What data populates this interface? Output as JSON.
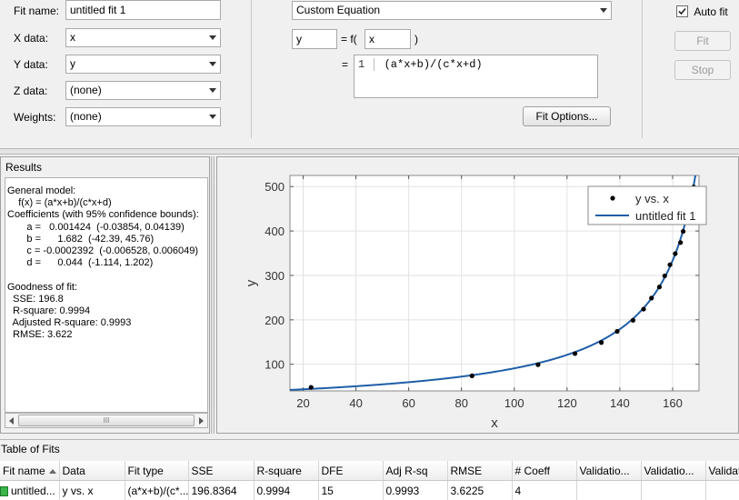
{
  "fit_name": {
    "label": "Fit name:",
    "value": "untitled fit 1"
  },
  "selectors": [
    {
      "label": "X data:",
      "value": "x"
    },
    {
      "label": "Y data:",
      "value": "y"
    },
    {
      "label": "Z data:",
      "value": "(none)"
    },
    {
      "label": "Weights:",
      "value": "(none)"
    }
  ],
  "equation": {
    "type": "Custom Equation",
    "lhs": "y",
    "func_prefix": "= f(",
    "arg": "x",
    "func_suffix": ")",
    "eq_prefix": "=",
    "line_number": "1",
    "expr": "(a*x+b)/(c*x+d)",
    "fit_options_label": "Fit Options..."
  },
  "controls": {
    "auto_fit_label": "Auto fit",
    "auto_fit_checked": true,
    "fit_label": "Fit",
    "stop_label": "Stop"
  },
  "results": {
    "title": "Results",
    "text": "General model:\n    f(x) = (a*x+b)/(c*x+d)\nCoefficients (with 95% confidence bounds):\n       a =   0.001424  (-0.03854, 0.04139)\n       b =      1.682  (-42.39, 45.76)\n       c = -0.0002392  (-0.006528, 0.006049)\n       d =      0.044  (-1.114, 1.202)\n\nGoodness of fit:\n  SSE: 196.8\n  R-square: 0.9994\n  Adjusted R-square: 0.9993\n  RMSE: 3.622",
    "scroll_thumb": "III"
  },
  "chart_data": {
    "type": "scatter",
    "xlabel": "x",
    "ylabel": "y",
    "xlim": [
      15,
      170
    ],
    "ylim": [
      40,
      525
    ],
    "xticks": [
      20,
      40,
      60,
      80,
      100,
      120,
      140,
      160
    ],
    "yticks": [
      100,
      200,
      300,
      400,
      500
    ],
    "grid": true,
    "legend_position": "top-right",
    "series": [
      {
        "name": "y vs. x",
        "kind": "points",
        "color": "#000000",
        "x": [
          23,
          84,
          109,
          123,
          133,
          139,
          145,
          149,
          152,
          155,
          157,
          159,
          161,
          163,
          164,
          165,
          168
        ],
        "y": [
          48,
          74,
          99,
          124,
          149,
          174,
          199,
          224,
          249,
          274,
          299,
          324,
          349,
          374,
          399,
          424,
          499
        ]
      },
      {
        "name": "untitled fit 1",
        "kind": "line",
        "color": "#1f5ea8",
        "model": {
          "a": 0.001424,
          "b": 1.682,
          "c": -0.0002392,
          "d": 0.044
        }
      }
    ]
  },
  "table": {
    "title": "Table of Fits",
    "columns": [
      "Fit name",
      "Data",
      "Fit type",
      "SSE",
      "R-square",
      "DFE",
      "Adj R-sq",
      "RMSE",
      "# Coeff",
      "Validatio...",
      "Validatio...",
      "Validat"
    ],
    "rows": [
      [
        "untitled...",
        "y vs. x",
        "(a*x+b)/(c*...",
        "196.8364",
        "0.9994",
        "15",
        "0.9993",
        "3.6225",
        "4",
        "",
        "",
        ""
      ]
    ]
  }
}
